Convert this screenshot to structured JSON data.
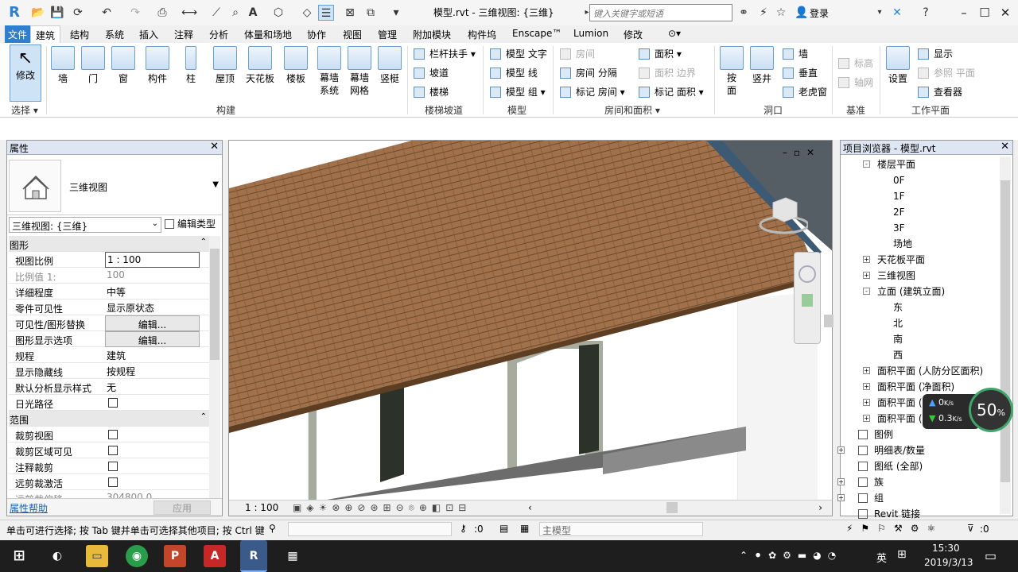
{
  "titlebar": {
    "app_letter": "R",
    "title": "模型.rvt - 三维视图: {三维}",
    "search_placeholder": "键入关键字或短语",
    "login": "登录",
    "accent": "#2f7fd1"
  },
  "menu": {
    "tabs": [
      "文件",
      "建筑",
      "结构",
      "系统",
      "插入",
      "注释",
      "分析",
      "体量和场地",
      "协作",
      "视图",
      "管理",
      "附加模块",
      "构件坞",
      "Enscape™",
      "Lumion",
      "修改"
    ]
  },
  "ribbon": {
    "select": {
      "modify": "修改",
      "group": "选择 ▾"
    },
    "build": {
      "items": [
        "墙",
        "门",
        "窗",
        "构件",
        "柱",
        "屋顶",
        "天花板",
        "楼板",
        "幕墙\n系统",
        "幕墙\n网格",
        "竖梃"
      ],
      "group": "构建"
    },
    "stairs": {
      "items": [
        "栏杆扶手",
        "坡道",
        "楼梯"
      ],
      "group": "楼梯坡道"
    },
    "model": {
      "items": [
        "模型 文字",
        "模型 线",
        "模型 组"
      ],
      "group": "模型"
    },
    "room": {
      "items": [
        "房间",
        "房间 分隔",
        "标记 房间",
        "面积",
        "面积 边界",
        "标记 面积"
      ],
      "group": "房间和面积 ▾"
    },
    "opening": {
      "items": [
        "按\n面",
        "竖井",
        "墙",
        "垂直",
        "老虎窗"
      ],
      "group": "洞口"
    },
    "datum": {
      "items": [
        "标高",
        "轴网"
      ],
      "group": "基准"
    },
    "workplane": {
      "items": [
        "设置",
        "显示",
        "参照 平面",
        "查看器"
      ],
      "group": "工作平面"
    }
  },
  "properties": {
    "title": "属性",
    "type_name": "三维视图",
    "view_combo": "三维视图: {三维}",
    "edit_type": "编辑类型",
    "rows": [
      {
        "k": "图形",
        "section": true
      },
      {
        "k": "视图比例",
        "v": "1 : 100",
        "kind": "box"
      },
      {
        "k": "比例值 1:",
        "v": "100",
        "kind": "dis"
      },
      {
        "k": "详细程度",
        "v": "中等"
      },
      {
        "k": "零件可见性",
        "v": "显示原状态"
      },
      {
        "k": "可见性/图形替换",
        "v": "编辑...",
        "kind": "btn"
      },
      {
        "k": "图形显示选项",
        "v": "编辑...",
        "kind": "btn"
      },
      {
        "k": "规程",
        "v": "建筑"
      },
      {
        "k": "显示隐藏线",
        "v": "按规程"
      },
      {
        "k": "默认分析显示样式",
        "v": "无"
      },
      {
        "k": "日光路径",
        "v": "",
        "kind": "cb"
      },
      {
        "k": "范围",
        "section": true
      },
      {
        "k": "裁剪视图",
        "v": "",
        "kind": "cb"
      },
      {
        "k": "裁剪区域可见",
        "v": "",
        "kind": "cb"
      },
      {
        "k": "注释裁剪",
        "v": "",
        "kind": "cb"
      },
      {
        "k": "远剪裁激活",
        "v": "",
        "kind": "cb"
      },
      {
        "k": "远剪裁偏移",
        "v": "304800.0",
        "kind": "dis"
      }
    ],
    "help": "属性帮助",
    "apply": "应用"
  },
  "viewport": {
    "scale": "1 : 100",
    "roof_color": "#a0714a",
    "wall_color": "#ffffff"
  },
  "browser": {
    "title": "项目浏览器 - 模型.rvt",
    "nodes": [
      {
        "t": "楼层平面",
        "lvl": 1,
        "exp": "-"
      },
      {
        "t": "0F",
        "lvl": 2
      },
      {
        "t": "1F",
        "lvl": 2
      },
      {
        "t": "2F",
        "lvl": 2
      },
      {
        "t": "3F",
        "lvl": 2
      },
      {
        "t": "场地",
        "lvl": 2
      },
      {
        "t": "天花板平面",
        "lvl": 1,
        "exp": "+"
      },
      {
        "t": "三维视图",
        "lvl": 1,
        "exp": "+"
      },
      {
        "t": "立面 (建筑立面)",
        "lvl": 1,
        "exp": "-"
      },
      {
        "t": "东",
        "lvl": 2
      },
      {
        "t": "北",
        "lvl": 2
      },
      {
        "t": "南",
        "lvl": 2
      },
      {
        "t": "西",
        "lvl": 2
      },
      {
        "t": "面积平面 (人防分区面积)",
        "lvl": 1,
        "exp": "+"
      },
      {
        "t": "面积平面 (净面积)",
        "lvl": 1,
        "exp": "+"
      },
      {
        "t": "面积平面 (",
        "lvl": 1,
        "exp": "+"
      },
      {
        "t": "面积平面 (",
        "lvl": 1,
        "exp": "+"
      },
      {
        "t": "图例",
        "lvl": 0
      },
      {
        "t": "明细表/数量",
        "lvl": 0,
        "exp": "+"
      },
      {
        "t": "图纸 (全部)",
        "lvl": 0
      },
      {
        "t": "族",
        "lvl": 0,
        "exp": "+"
      },
      {
        "t": "组",
        "lvl": 0,
        "exp": "+"
      },
      {
        "t": "Revit 链接",
        "lvl": 0
      }
    ]
  },
  "netspeed": {
    "up": "0",
    "up_unit": "K/s",
    "down": "0.3",
    "down_unit": "K/s",
    "pct": "50",
    "pct_unit": "%"
  },
  "statusbar": {
    "hint": "单击可进行选择; 按 Tab 键并单击可选择其他项目; 按 Ctrl 键",
    "zero1": ":0",
    "model": "主模型",
    "filter": ":0"
  },
  "taskbar": {
    "ime": "英",
    "time": "15:30",
    "date": "2019/3/13"
  }
}
